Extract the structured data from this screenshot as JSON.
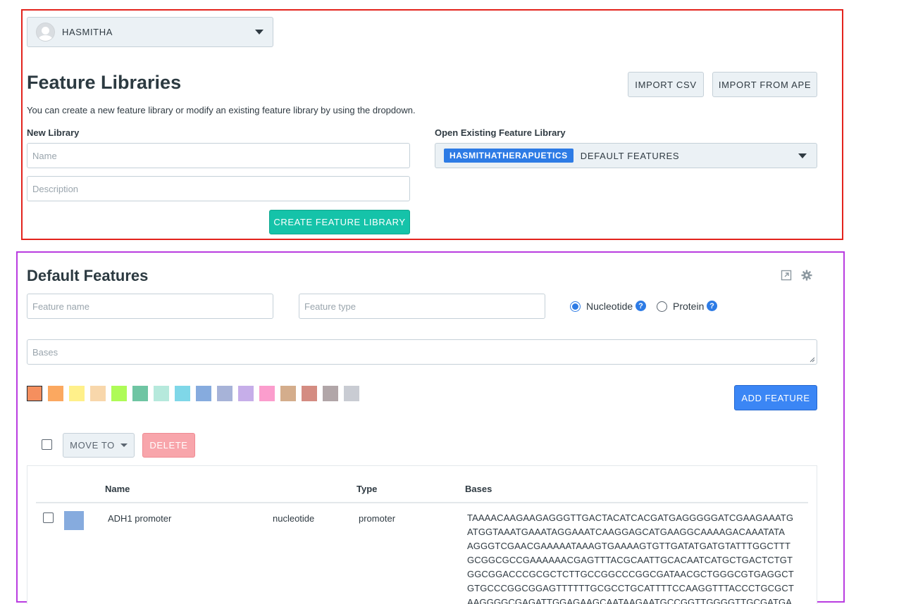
{
  "user": {
    "name": "HASMITHA"
  },
  "library": {
    "title": "Feature Libraries",
    "import_csv": "IMPORT CSV",
    "import_ape": "IMPORT FROM APE",
    "description": "You can create a new feature library or modify an existing feature library by using the dropdown.",
    "new_label": "New Library",
    "name_placeholder": "Name",
    "desc_placeholder": "Description",
    "create_button": "CREATE FEATURE LIBRARY",
    "existing_label": "Open Existing Feature Library",
    "existing_tag": "HASMITHATHERAPUETICS",
    "existing_value": "DEFAULT FEATURES"
  },
  "features": {
    "title": "Default Features",
    "feature_name_placeholder": "Feature name",
    "feature_type_placeholder": "Feature type",
    "radio_nucleotide": "Nucleotide",
    "radio_protein": "Protein",
    "selected_radio": "Nucleotide",
    "bases_placeholder": "Bases",
    "add_button": "ADD FEATURE",
    "move_to": "MOVE TO",
    "delete": "DELETE",
    "palette": [
      "#f58f5e",
      "#fba860",
      "#fff08a",
      "#f8d7ab",
      "#aefb57",
      "#6fc5a3",
      "#b6e9dc",
      "#7fd7e8",
      "#86abde",
      "#a7b3d8",
      "#c6aee9",
      "#fb9dcd",
      "#d4ad8c",
      "#d48c82",
      "#b1a6a8",
      "#c9ccd3"
    ],
    "selected_color": "#f58f5e",
    "columns": {
      "name": "Name",
      "type": "Type",
      "bases": "Bases"
    },
    "rows": [
      {
        "color": "#86abde",
        "name": "ADH1 promoter",
        "kind": "nucleotide",
        "type": "promoter",
        "bases_lines": [
          "TAAAACAAGAAGAGGGTTGACTACATCACGATGAGGGGGATCGAAGAAATG",
          "ATGGTAAATGAAATAGGAAATCAAGGAGCATGAAGGCAAAAGACAAATATA",
          "AGGGTCGAACGAAAAATAAAGTGAAAAGTGTTGATATGATGTATTTGGCTTT",
          "GCGGCGCCGAAAAAACGAGTTTACGCAATTGCACAATCATGCTGACTCTGT",
          "GGCGGACCCGCGCTCTTGCCGGCCCGGCGATAACGCTGGGCGTGAGGCT",
          "GTGCCCGGCGGAGTTTTTTGCGCCTGCATTTTCCAAGGTTTACCCTGCGCT",
          "AAGGGGCGAGATTGGAGAAGCAATAAGAATGCCGGTTGGGGTTGCGATGA"
        ]
      }
    ]
  }
}
